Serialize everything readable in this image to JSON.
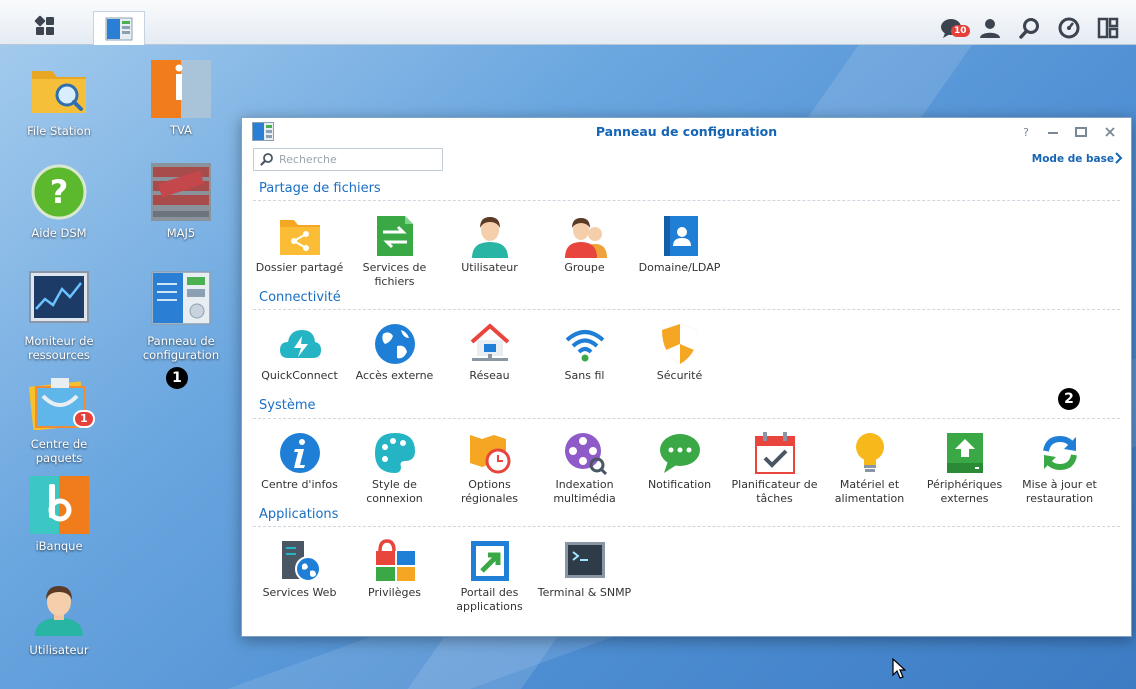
{
  "taskbar": {
    "notification_count": "10",
    "icons": [
      "main-menu-icon",
      "control-panel-icon",
      "chat-icon",
      "user-icon",
      "search-icon",
      "gauge-icon",
      "widgets-icon"
    ]
  },
  "desktop": {
    "icons": [
      {
        "name": "file-station",
        "label": "File Station"
      },
      {
        "name": "tva",
        "label": "TVA"
      },
      {
        "name": "aide-dsm",
        "label": "Aide DSM"
      },
      {
        "name": "maj5",
        "label": "MAJ5"
      },
      {
        "name": "moniteur",
        "label": "Moniteur de ressources"
      },
      {
        "name": "panneau",
        "label": "Panneau de configuration"
      },
      {
        "name": "centre-paquets",
        "label": "Centre de paquets",
        "badge": "1"
      },
      {
        "name": "ibanque",
        "label": "iBanque"
      },
      {
        "name": "utilisateur",
        "label": "Utilisateur"
      }
    ],
    "callout1": "1",
    "callout2": "2"
  },
  "window": {
    "title": "Panneau de configuration",
    "search_placeholder": "Recherche",
    "mode_link": "Mode de base",
    "sections": [
      {
        "title": "Partage de fichiers",
        "items": [
          "Dossier partagé",
          "Services de fichiers",
          "Utilisateur",
          "Groupe",
          "Domaine/LDAP"
        ]
      },
      {
        "title": "Connectivité",
        "items": [
          "QuickConnect",
          "Accès externe",
          "Réseau",
          "Sans fil",
          "Sécurité"
        ]
      },
      {
        "title": "Système",
        "items": [
          "Centre d'infos",
          "Style de connexion",
          "Options régionales",
          "Indexation multimédia",
          "Notification",
          "Planificateur de tâches",
          "Matériel et alimentation",
          "Périphériques externes",
          "Mise à jour et restauration"
        ]
      },
      {
        "title": "Applications",
        "items": [
          "Services Web",
          "Privilèges",
          "Portail des applications",
          "Terminal & SNMP"
        ]
      }
    ]
  },
  "colors": {
    "accent": "#1565b5",
    "section_title": "#1a6fc4",
    "badge": "#e5403a"
  }
}
